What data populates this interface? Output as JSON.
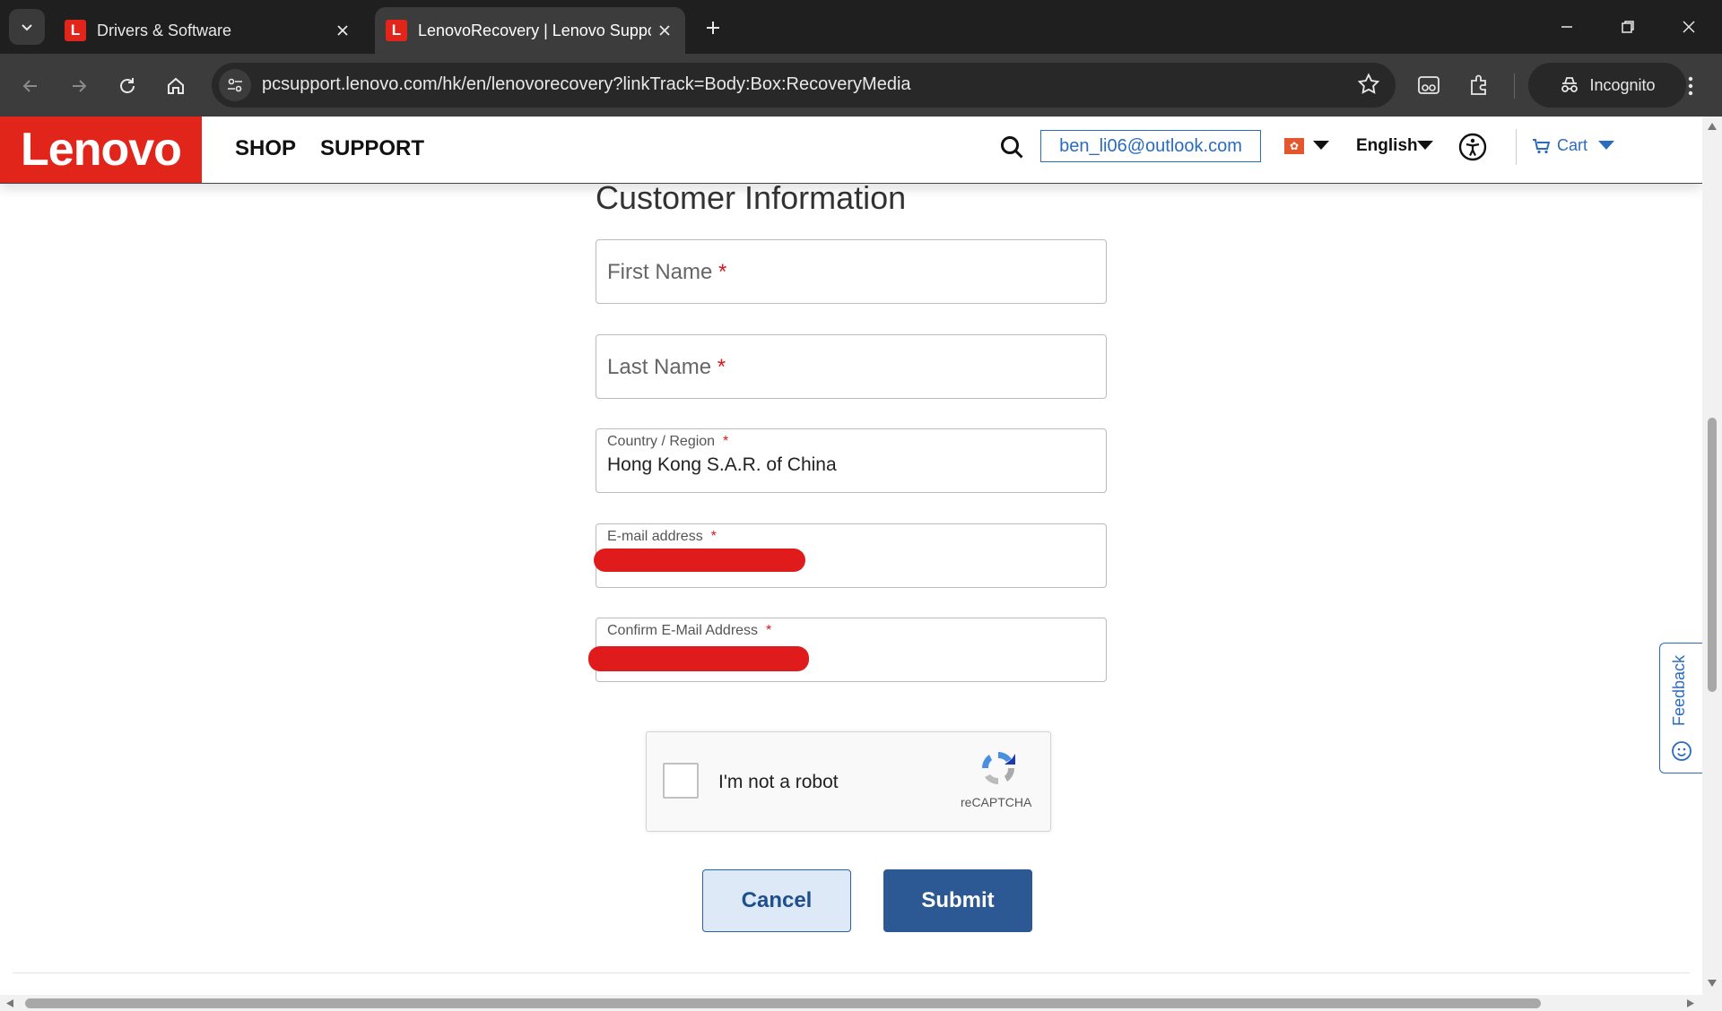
{
  "browser": {
    "tabs": [
      {
        "title": "Drivers & Software",
        "favicon": "L",
        "active": false
      },
      {
        "title": "LenovoRecovery | Lenovo Support",
        "favicon": "L",
        "active": true
      }
    ],
    "url": "pcsupport.lenovo.com/hk/en/lenovorecovery?linkTrack=Body:Box:RecoveryMedia",
    "incognito_label": "Incognito"
  },
  "header": {
    "logo": "Lenovo",
    "nav": [
      "SHOP",
      "SUPPORT"
    ],
    "account": "ben_li06@outlook.com",
    "language": "English",
    "cart": "Cart"
  },
  "form": {
    "title": "Customer Information",
    "required_mark": "*",
    "first_name_placeholder": "First Name",
    "last_name_placeholder": "Last Name",
    "country_label": "Country / Region",
    "country_value": "Hong Kong S.A.R. of China",
    "email_label": "E-mail address",
    "confirm_email_label": "Confirm E-Mail Address"
  },
  "captcha": {
    "label": "I'm not a robot",
    "brand": "reCAPTCHA",
    "checked": false
  },
  "buttons": {
    "cancel": "Cancel",
    "submit": "Submit"
  },
  "feedback": {
    "label": "Feedback"
  },
  "colors": {
    "brand_red": "#e1251b",
    "link_blue": "#2b6bbf",
    "submit_blue": "#2c5994",
    "redaction": "#e01b1b"
  }
}
